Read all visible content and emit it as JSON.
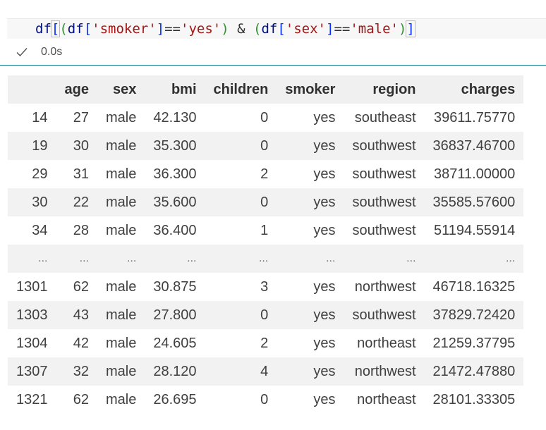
{
  "code": {
    "tokens": {
      "df1": "df",
      "b1_open": "[",
      "p1_open": "(",
      "df2": "df",
      "b2_open": "[",
      "s1": "'smoker'",
      "b2_close": "]",
      "eq1": "==",
      "s2": "'yes'",
      "p1_close": ")",
      "amp": " & ",
      "p2_open": "(",
      "df3": "df",
      "b3_open": "[",
      "s3": "'sex'",
      "b3_close": "]",
      "eq2": "==",
      "s4": "'male'",
      "p2_close": ")",
      "b1_close": "]"
    }
  },
  "status": {
    "time": "0.0s",
    "icon": "check-icon"
  },
  "table": {
    "columns": [
      "",
      "age",
      "sex",
      "bmi",
      "children",
      "smoker",
      "region",
      "charges"
    ],
    "rows": [
      [
        "14",
        "27",
        "male",
        "42.130",
        "0",
        "yes",
        "southeast",
        "39611.75770"
      ],
      [
        "19",
        "30",
        "male",
        "35.300",
        "0",
        "yes",
        "southwest",
        "36837.46700"
      ],
      [
        "29",
        "31",
        "male",
        "36.300",
        "2",
        "yes",
        "southwest",
        "38711.00000"
      ],
      [
        "30",
        "22",
        "male",
        "35.600",
        "0",
        "yes",
        "southwest",
        "35585.57600"
      ],
      [
        "34",
        "28",
        "male",
        "36.400",
        "1",
        "yes",
        "southwest",
        "51194.55914"
      ],
      [
        "...",
        "...",
        "...",
        "...",
        "...",
        "...",
        "...",
        "..."
      ],
      [
        "1301",
        "62",
        "male",
        "30.875",
        "3",
        "yes",
        "northwest",
        "46718.16325"
      ],
      [
        "1303",
        "43",
        "male",
        "27.800",
        "0",
        "yes",
        "southwest",
        "37829.72420"
      ],
      [
        "1304",
        "42",
        "male",
        "24.605",
        "2",
        "yes",
        "northeast",
        "21259.37795"
      ],
      [
        "1307",
        "32",
        "male",
        "28.120",
        "4",
        "yes",
        "northwest",
        "21472.47880"
      ],
      [
        "1321",
        "62",
        "male",
        "26.695",
        "0",
        "yes",
        "northeast",
        "28101.33305"
      ]
    ]
  },
  "colors": {
    "cell_border": "#127a8a",
    "string": "#a31515",
    "identifier": "#001080",
    "bracket_outer": "#0431fa",
    "bracket_inner": "#319331"
  }
}
